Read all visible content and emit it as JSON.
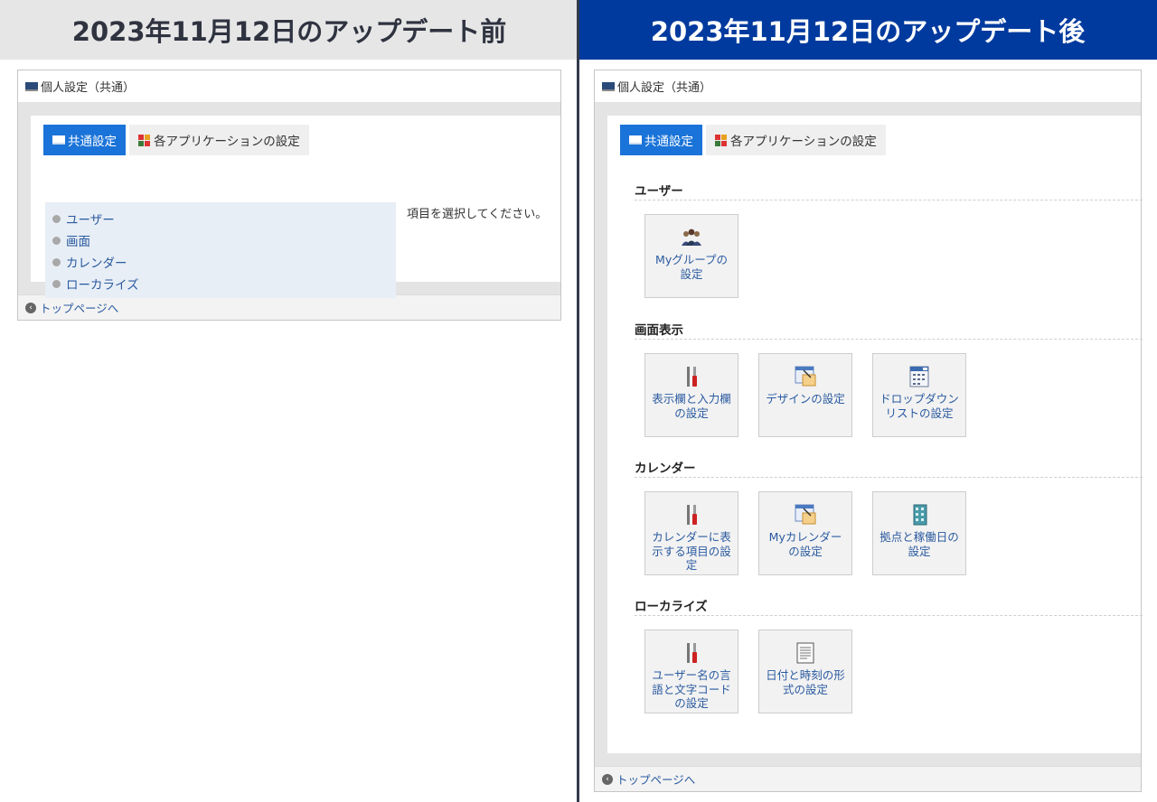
{
  "headers": {
    "before": "2023年11月12日のアップデート前",
    "after": "2023年11月12日のアップデート後"
  },
  "panel": {
    "title": "個人設定（共通）",
    "tab_common": "共通設定",
    "tab_apps": "各アプリケーションの設定",
    "footer": "トップページへ"
  },
  "before": {
    "items": [
      "ユーザー",
      "画面",
      "カレンダー",
      "ローカライズ"
    ],
    "hint": "項目を選択してください。"
  },
  "after": {
    "sections": [
      {
        "title": "ユーザー",
        "cards": [
          {
            "icon": "group-icon",
            "lines": [
              "Myグループの",
              "設定"
            ]
          }
        ]
      },
      {
        "title": "画面表示",
        "cards": [
          {
            "icon": "tools-icon",
            "lines": [
              "表示欄と入力欄",
              "の設定"
            ]
          },
          {
            "icon": "design-icon",
            "lines": [
              "デザインの設定"
            ]
          },
          {
            "icon": "dropdown-icon",
            "lines": [
              "ドロップダウン",
              "リストの設定"
            ]
          }
        ]
      },
      {
        "title": "カレンダー",
        "cards": [
          {
            "icon": "tools-icon",
            "lines": [
              "カレンダーに表",
              "示する項目の設",
              "定"
            ]
          },
          {
            "icon": "design-icon",
            "lines": [
              "Myカレンダー",
              "の設定"
            ]
          },
          {
            "icon": "building-icon",
            "lines": [
              "拠点と稼働日の",
              "設定"
            ]
          }
        ]
      },
      {
        "title": "ローカライズ",
        "cards": [
          {
            "icon": "tools-icon",
            "lines": [
              "ユーザー名の言",
              "語と文字コード",
              "の設定"
            ]
          },
          {
            "icon": "document-icon",
            "lines": [
              "日付と時刻の形",
              "式の設定"
            ]
          }
        ]
      }
    ]
  },
  "colors": {
    "accent": "#1a73d8",
    "header_after_bg": "#003a9e",
    "header_before_bg": "#e6e6e6",
    "link": "#2a5aa0"
  }
}
